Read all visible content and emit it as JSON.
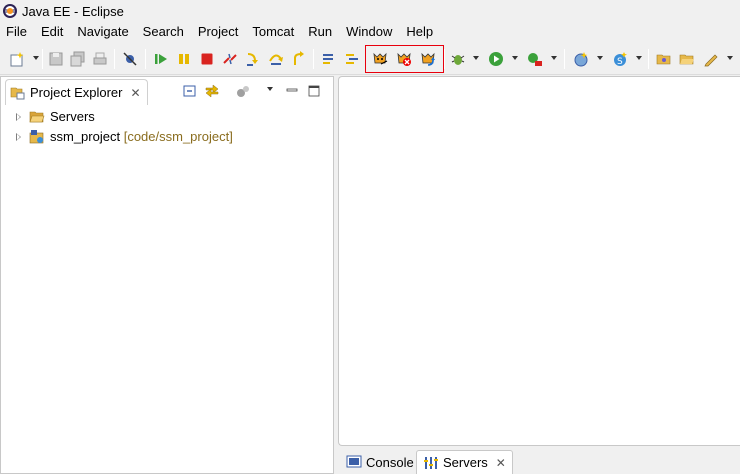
{
  "window": {
    "title": "Java EE - Eclipse"
  },
  "menu": {
    "items": [
      "File",
      "Edit",
      "Navigate",
      "Search",
      "Project",
      "Tomcat",
      "Run",
      "Window",
      "Help"
    ]
  },
  "toolbar": {
    "icons": [
      "new-icon",
      "save-icon",
      "save-all-icon",
      "print-icon",
      "skip-breakpoints-icon",
      "resume-icon",
      "suspend-icon",
      "terminate-icon",
      "disconnect-icon",
      "step-into-icon",
      "step-over-icon",
      "step-return-icon",
      "drop-to-frame-icon",
      "use-step-filters-icon",
      "start-tomcat-icon",
      "stop-tomcat-icon",
      "restart-tomcat-icon",
      "debug-icon",
      "run-icon",
      "external-tools-icon",
      "new-server-icon",
      "new-class-icon",
      "open-folder-icon",
      "open-project-icon",
      "pen-icon"
    ],
    "highlight_color": "#e8000d"
  },
  "project_explorer": {
    "tab_label": "Project Explorer",
    "tab_close": "✕",
    "tree": [
      {
        "label": "Servers",
        "decoration": ""
      },
      {
        "label": "ssm_project",
        "decoration": "[code/ssm_project]"
      }
    ]
  },
  "bottom_tabs": {
    "console": "Console",
    "servers": "Servers",
    "close": "✕"
  }
}
